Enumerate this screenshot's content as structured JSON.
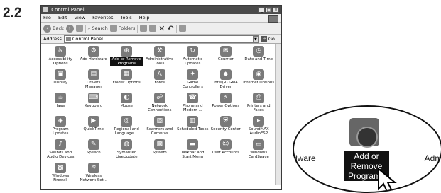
{
  "step": "2.2",
  "window": {
    "title": "Control Panel",
    "controls": [
      "_",
      "□",
      "×"
    ]
  },
  "menu": [
    "File",
    "Edit",
    "View",
    "Favorites",
    "Tools",
    "Help"
  ],
  "toolbar": {
    "back": "Back",
    "search": "Search",
    "folders": "Folders"
  },
  "address": {
    "label": "Address",
    "value": "Control Panel",
    "go": "Go"
  },
  "items": [
    {
      "label": "Accessibility Options",
      "icon": "accessibility-icon"
    },
    {
      "label": "Add Hardware",
      "icon": "hardware-icon"
    },
    {
      "label": "Add or Remove Programs",
      "icon": "add-remove-programs-icon",
      "selected": true
    },
    {
      "label": "Administrative Tools",
      "icon": "admin-tools-icon"
    },
    {
      "label": "Automatic Updates",
      "icon": "updates-icon"
    },
    {
      "label": "Courrier",
      "icon": "mail-icon"
    },
    {
      "label": "Date and Time",
      "icon": "clock-icon"
    },
    {
      "label": "Display",
      "icon": "display-icon"
    },
    {
      "label": "Drivers Manager",
      "icon": "drivers-icon"
    },
    {
      "label": "Folder Options",
      "icon": "folder-icon"
    },
    {
      "label": "Fonts",
      "icon": "fonts-icon"
    },
    {
      "label": "Game Controllers",
      "icon": "gamepad-icon"
    },
    {
      "label": "Intel(R) GMA Driver",
      "icon": "intel-icon"
    },
    {
      "label": "Internet Options",
      "icon": "globe-icon"
    },
    {
      "label": "Java",
      "icon": "java-icon"
    },
    {
      "label": "Keyboard",
      "icon": "keyboard-icon"
    },
    {
      "label": "Mouse",
      "icon": "mouse-icon"
    },
    {
      "label": "Network Connections",
      "icon": "network-icon"
    },
    {
      "label": "Phone and Modem ...",
      "icon": "phone-icon"
    },
    {
      "label": "Power Options",
      "icon": "power-icon"
    },
    {
      "label": "Printers and Faxes",
      "icon": "printer-icon"
    },
    {
      "label": "Program Updates",
      "icon": "program-updates-icon"
    },
    {
      "label": "QuickTime",
      "icon": "quicktime-icon"
    },
    {
      "label": "Regional and Language ...",
      "icon": "regional-icon"
    },
    {
      "label": "Scanners and Cameras",
      "icon": "scanner-icon"
    },
    {
      "label": "Scheduled Tasks",
      "icon": "tasks-icon"
    },
    {
      "label": "Security Center",
      "icon": "security-icon"
    },
    {
      "label": "SoundMAX AudioESP",
      "icon": "soundmax-icon"
    },
    {
      "label": "Sounds and Audio Devices",
      "icon": "sound-icon"
    },
    {
      "label": "Speech",
      "icon": "speech-icon"
    },
    {
      "label": "Symantec LiveUpdate",
      "icon": "symantec-icon"
    },
    {
      "label": "System",
      "icon": "system-icon"
    },
    {
      "label": "Taskbar and Start Menu",
      "icon": "taskbar-icon"
    },
    {
      "label": "User Accounts",
      "icon": "users-icon"
    },
    {
      "label": "Windows CardSpace",
      "icon": "cardspace-icon"
    },
    {
      "label": "Windows Firewall",
      "icon": "firewall-icon"
    },
    {
      "label": "Wireless Network Set...",
      "icon": "wireless-icon"
    }
  ],
  "zoom": {
    "left_text": "dware",
    "label_line1": "Add or",
    "label_line2": "Remove",
    "label_line3": "Programs",
    "right_text": "Admi"
  }
}
